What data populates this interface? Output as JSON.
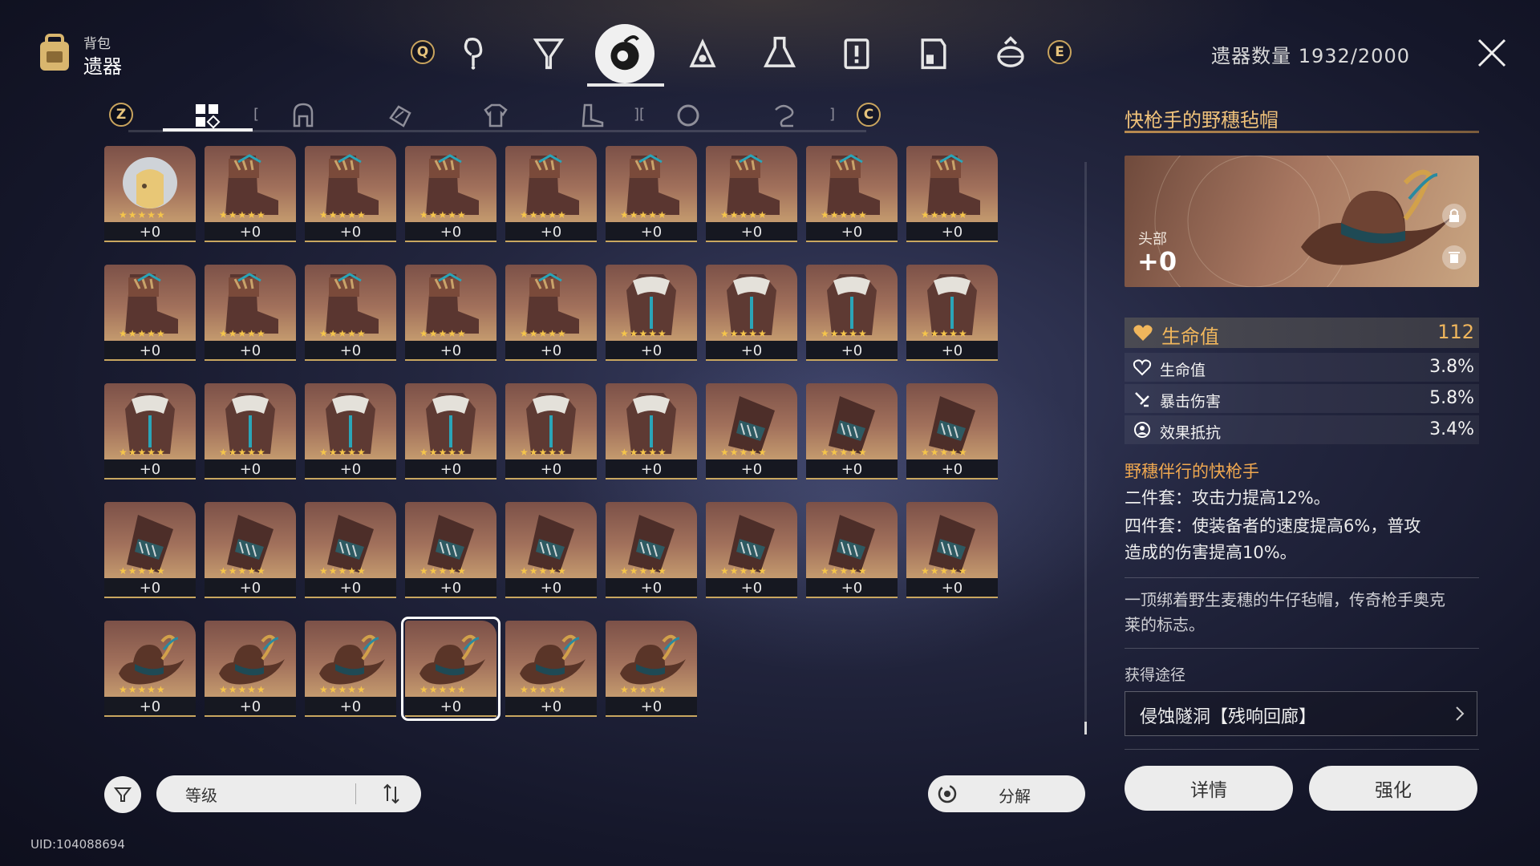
{
  "header": {
    "bag_sub": "背包",
    "bag_title": "遗器",
    "key_left": "Q",
    "key_right": "E",
    "count_label": "遗器数量 1932/2000",
    "categories": [
      "trailblaze-icon",
      "light-cone-icon",
      "relic-icon",
      "upgrade-material-icon",
      "consumable-icon",
      "mission-icon",
      "valuables-icon",
      "other-icon"
    ],
    "active_category": "relic-icon"
  },
  "slot_tabs": {
    "key_left": "Z",
    "key_right": "C",
    "tabs": [
      "all-icon",
      "head-icon",
      "hands-icon",
      "body-icon",
      "feet-icon",
      "sphere-icon",
      "rope-icon"
    ],
    "active": "all-icon"
  },
  "grid": {
    "items": [
      {
        "type": "head-helm",
        "level": "+0",
        "stars": 5
      },
      {
        "type": "boots",
        "level": "+0",
        "stars": 5
      },
      {
        "type": "boots",
        "level": "+0",
        "stars": 5
      },
      {
        "type": "boots",
        "level": "+0",
        "stars": 5
      },
      {
        "type": "boots",
        "level": "+0",
        "stars": 5
      },
      {
        "type": "boots",
        "level": "+0",
        "stars": 5
      },
      {
        "type": "boots",
        "level": "+0",
        "stars": 5
      },
      {
        "type": "boots",
        "level": "+0",
        "stars": 5
      },
      {
        "type": "boots",
        "level": "+0",
        "stars": 5
      },
      {
        "type": "boots",
        "level": "+0",
        "stars": 5
      },
      {
        "type": "boots",
        "level": "+0",
        "stars": 5
      },
      {
        "type": "boots",
        "level": "+0",
        "stars": 5
      },
      {
        "type": "boots",
        "level": "+0",
        "stars": 5
      },
      {
        "type": "boots",
        "level": "+0",
        "stars": 5
      },
      {
        "type": "coat",
        "level": "+0",
        "stars": 5
      },
      {
        "type": "coat",
        "level": "+0",
        "stars": 5
      },
      {
        "type": "coat",
        "level": "+0",
        "stars": 5
      },
      {
        "type": "coat",
        "level": "+0",
        "stars": 5
      },
      {
        "type": "coat",
        "level": "+0",
        "stars": 5
      },
      {
        "type": "coat",
        "level": "+0",
        "stars": 5
      },
      {
        "type": "coat",
        "level": "+0",
        "stars": 5
      },
      {
        "type": "coat",
        "level": "+0",
        "stars": 5
      },
      {
        "type": "coat",
        "level": "+0",
        "stars": 5
      },
      {
        "type": "coat",
        "level": "+0",
        "stars": 5
      },
      {
        "type": "glove",
        "level": "+0",
        "stars": 5
      },
      {
        "type": "glove",
        "level": "+0",
        "stars": 5
      },
      {
        "type": "glove",
        "level": "+0",
        "stars": 5
      },
      {
        "type": "glove",
        "level": "+0",
        "stars": 5
      },
      {
        "type": "glove",
        "level": "+0",
        "stars": 5
      },
      {
        "type": "glove",
        "level": "+0",
        "stars": 5
      },
      {
        "type": "glove",
        "level": "+0",
        "stars": 5
      },
      {
        "type": "glove",
        "level": "+0",
        "stars": 5
      },
      {
        "type": "glove",
        "level": "+0",
        "stars": 5
      },
      {
        "type": "glove",
        "level": "+0",
        "stars": 5
      },
      {
        "type": "glove",
        "level": "+0",
        "stars": 5
      },
      {
        "type": "glove",
        "level": "+0",
        "stars": 5
      },
      {
        "type": "hat",
        "level": "+0",
        "stars": 5
      },
      {
        "type": "hat",
        "level": "+0",
        "stars": 5
      },
      {
        "type": "hat",
        "level": "+0",
        "stars": 5
      },
      {
        "type": "hat",
        "level": "+0",
        "stars": 5,
        "selected": true
      },
      {
        "type": "hat",
        "level": "+0",
        "stars": 5
      },
      {
        "type": "hat",
        "level": "+0",
        "stars": 5
      }
    ]
  },
  "bottom": {
    "sort_label": "等级",
    "salvage_label": "分解",
    "uid": "UID:104088694"
  },
  "detail": {
    "name": "快枪手的野穗毡帽",
    "slot": "头部",
    "level": "+0",
    "main_stat": {
      "name": "生命值",
      "value": "112",
      "icon": "heart-icon"
    },
    "sub_stats": [
      {
        "name": "生命值",
        "value": "3.8%",
        "icon": "heart-outline-icon"
      },
      {
        "name": "暴击伤害",
        "value": "5.8%",
        "icon": "crit-damage-icon"
      },
      {
        "name": "效果抵抗",
        "value": "3.4%",
        "icon": "effect-res-icon"
      }
    ],
    "set_name": "野穗伴行的快枪手",
    "set_2pc": "二件套：攻击力提高12%。",
    "set_4pc_line1": "四件套：使装备者的速度提高6%，普攻",
    "set_4pc_line2": "造成的伤害提高10%。",
    "desc_line1": "一顶绑着野生麦穗的牛仔毡帽，传奇枪手奥克",
    "desc_line2": "莱的标志。",
    "source_label": "获得途径",
    "source_value": "侵蚀隧洞【残响回廊】",
    "details_button": "详情",
    "enhance_button": "强化"
  },
  "colors": {
    "accent_gold": "#f0c27a",
    "stat_orange": "#f0b65c",
    "star": "#f5c54a",
    "card_bg": "#a1705b"
  }
}
